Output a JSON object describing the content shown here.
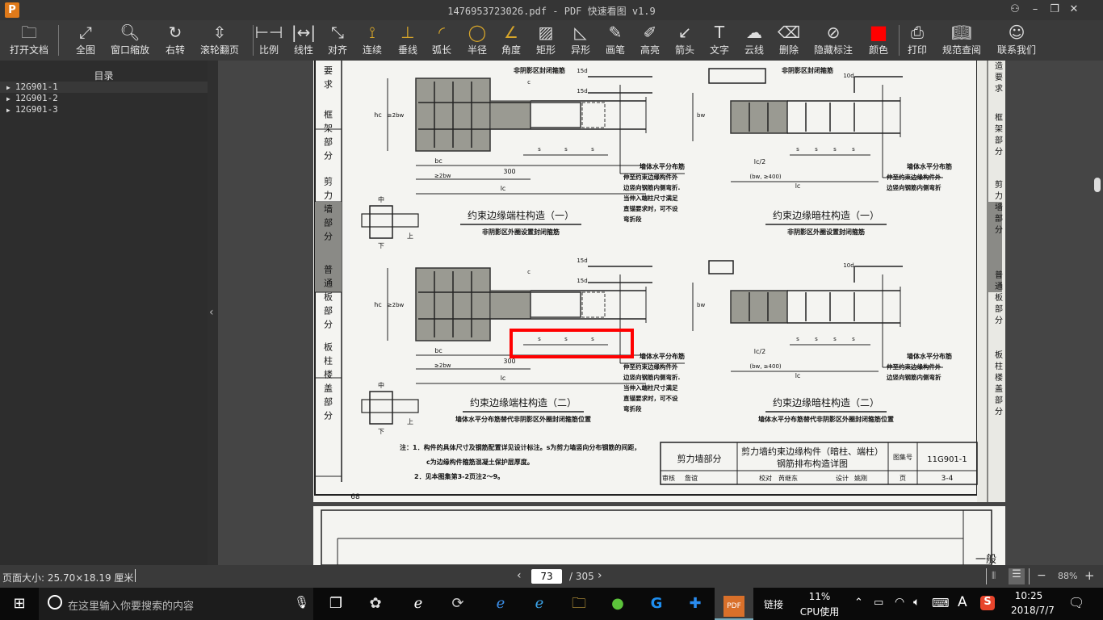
{
  "window": {
    "title": "1476953723026.pdf - PDF 快速看图 v1.9",
    "logo": "P",
    "controls": [
      "user-icon",
      "minimize-icon",
      "maximize-icon",
      "close-icon"
    ]
  },
  "toolbar": [
    {
      "label": "打开文档",
      "icon": "folder-icon",
      "g": "🗀"
    },
    {
      "label": "全图",
      "icon": "fit-all-icon",
      "g": "⤢"
    },
    {
      "label": "窗口缩放",
      "icon": "zoom-icon",
      "g": "🔍︎"
    },
    {
      "label": "右转",
      "icon": "rotate-right-icon",
      "g": "↻"
    },
    {
      "label": "滚轮翻页",
      "icon": "mouse-wheel-icon",
      "g": "⇳"
    },
    {
      "label": "比例",
      "icon": "scale-icon",
      "g": "⊢⊣"
    },
    {
      "label": "线性",
      "icon": "linear-measure-icon",
      "g": "|↔|"
    },
    {
      "label": "对齐",
      "icon": "aligned-measure-icon",
      "g": "⤡"
    },
    {
      "label": "连续",
      "icon": "continuous-measure-icon",
      "g": "⟟"
    },
    {
      "label": "垂线",
      "icon": "perpendicular-icon",
      "g": "⊥"
    },
    {
      "label": "弧长",
      "icon": "arc-length-icon",
      "g": "◜"
    },
    {
      "label": "半径",
      "icon": "radius-icon",
      "g": "◯"
    },
    {
      "label": "角度",
      "icon": "angle-icon",
      "g": "∠"
    },
    {
      "label": "矩形",
      "icon": "rectangle-area-icon",
      "g": "▨"
    },
    {
      "label": "异形",
      "icon": "polygon-area-icon",
      "g": "◺"
    },
    {
      "label": "画笔",
      "icon": "pen-icon",
      "g": "✎"
    },
    {
      "label": "高亮",
      "icon": "highlighter-icon",
      "g": "✐"
    },
    {
      "label": "箭头",
      "icon": "arrow-icon",
      "g": "↙"
    },
    {
      "label": "文字",
      "icon": "text-icon",
      "g": "T"
    },
    {
      "label": "云线",
      "icon": "cloud-line-icon",
      "g": "☁"
    },
    {
      "label": "删除",
      "icon": "eraser-icon",
      "g": "⌫"
    },
    {
      "label": "隐藏标注",
      "icon": "hide-annotations-icon",
      "g": "⊘"
    },
    {
      "label": "颜色",
      "icon": "color-swatch-icon",
      "g": "■"
    },
    {
      "label": "打印",
      "icon": "print-icon",
      "g": "⎙"
    },
    {
      "label": "规范查阅",
      "icon": "book-search-icon",
      "g": "📖︎"
    },
    {
      "label": "联系我们",
      "icon": "contact-qq-icon",
      "g": "☺"
    }
  ],
  "accent_color": "#ff0000",
  "sidebar": {
    "title": "目录",
    "items": [
      "12G901-1",
      "12G901-2",
      "12G901-3"
    ]
  },
  "page": {
    "side_tabs": [
      "般构造要求",
      "框架部分",
      "剪力墙部分",
      "普通板部分",
      "板柱楼盖部分"
    ],
    "right_tabs": [
      "般构造要求",
      "框架部分",
      "剪力墙部分",
      "普通板部分",
      "板柱楼盖部分"
    ],
    "labels": {
      "closed_stirrup": "非阴影区封闭箍筋",
      "d15": "15d",
      "d10": "10d",
      "c": "c",
      "s": "s",
      "hc": "hc",
      "ge2bw": "≥2bw",
      "bc": "bc",
      "b300": "300",
      "lc": "lc",
      "lc2": "lc/2",
      "bw": "bw",
      "bw400": "(bw, ≥400)",
      "mid": "中",
      "up": "上",
      "down": "下",
      "wall_bar": "墙体水平分布筋",
      "note_long": [
        "伸至约束边缘构件外",
        "边竖向钢筋内侧弯折.",
        "当伸入端柱尺寸满足",
        "直锚要求时，可不设",
        "弯折段"
      ],
      "note_short": [
        "伸至约束边缘构件外",
        "边竖向钢筋内侧弯折"
      ]
    },
    "captions": [
      {
        "title": "约束边缘端柱构造（一）",
        "sub": "非阴影区外圈设置封闭箍筋"
      },
      {
        "title": "约束边缘暗柱构造（一）",
        "sub": "非阴影区外圈设置封闭箍筋"
      },
      {
        "title": "约束边缘端柱构造（二）",
        "sub": "墙体水平分布筋替代非阴影区外圈封闭箍筋位置"
      },
      {
        "title": "约束边缘暗柱构造（二）",
        "sub": "墙体水平分布筋替代非阴影区外圈封闭箍筋位置"
      }
    ],
    "notes": [
      "注：1．构件的具体尺寸及钢筋配置详见设计标注。s为剪力墙竖向分布钢筋的间距，",
      "c为边缘构件箍筋混凝土保护层厚度。",
      "2．见本图集第3-2页注2～9。"
    ],
    "title_block": {
      "section": "剪力墙部分",
      "name1": "剪力墙约束边缘构件（暗柱、端柱）",
      "name2": "钢筋排布构造详图",
      "atlas_label": "图集号",
      "atlas": "11G901-1",
      "review": "审核",
      "reviewer": "詹谊",
      "check": "校对",
      "checker": "芮继东",
      "design": "设计",
      "designer": "姚刚",
      "page_label": "页",
      "page_no": "3-4"
    },
    "page_number": "68",
    "next_tab": "一般"
  },
  "status": {
    "page_size": "页面大小: 25.70×18.19 厘米",
    "current_page": "73",
    "total": "/ 305",
    "zoom": "88%",
    "minus": "−",
    "plus": "+"
  },
  "taskbar": {
    "search_placeholder": "在这里输入你要搜索的内容",
    "link": "链接",
    "cpu_pct": "11%",
    "cpu_label": "CPU使用",
    "time": "10:25",
    "date": "2018/7/7",
    "ime": "A",
    "pdf_app": "PDF"
  }
}
